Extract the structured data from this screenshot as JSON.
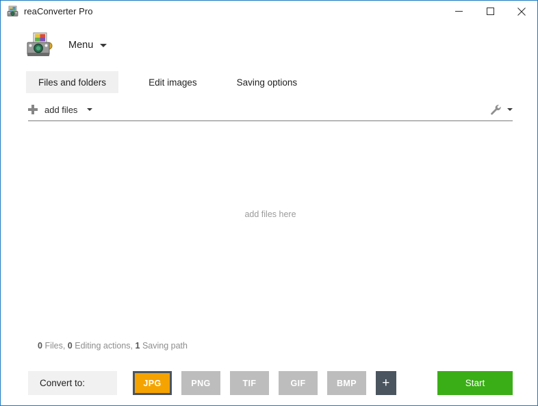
{
  "window": {
    "title": "reaConverter Pro",
    "icon": "app-scanner-icon",
    "border_color": "#1a7ac0",
    "controls": {
      "minimize": "minimize-icon",
      "maximize": "maximize-icon",
      "close": "close-icon"
    }
  },
  "menu": {
    "label": "Menu",
    "caret": "chevron-down-icon",
    "logo": "reaconverter-logo"
  },
  "tabs": [
    {
      "label": "Files and folders",
      "active": true
    },
    {
      "label": "Edit images",
      "active": false
    },
    {
      "label": "Saving options",
      "active": false
    }
  ],
  "toolbar": {
    "add_files_label": "add files",
    "add_files_icon": "plus-icon",
    "add_files_caret": "chevron-down-icon",
    "tools_icon": "wrench-icon",
    "tools_caret": "chevron-down-icon"
  },
  "drop_area": {
    "placeholder": "add files here"
  },
  "status": {
    "files_count": "0",
    "files_label": "Files,",
    "editing_count": "0",
    "editing_label": "Editing actions,",
    "saving_count": "1",
    "saving_label": "Saving path"
  },
  "bottom": {
    "convert_to_label": "Convert to:",
    "formats": [
      {
        "label": "JPG",
        "selected": true
      },
      {
        "label": "PNG",
        "selected": false
      },
      {
        "label": "TIF",
        "selected": false
      },
      {
        "label": "GIF",
        "selected": false
      },
      {
        "label": "BMP",
        "selected": false
      }
    ],
    "add_format_label": "+",
    "start_label": "Start"
  },
  "colors": {
    "accent_selected": "#f5a300",
    "format_default": "#bdbdbd",
    "add_format": "#4a5560",
    "start_green": "#3aae16",
    "window_border": "#1a7ac0",
    "tab_active_bg": "#f0f0f0"
  }
}
